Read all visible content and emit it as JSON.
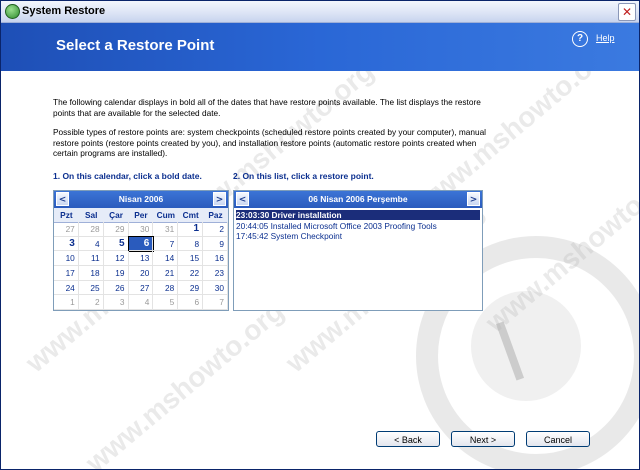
{
  "window": {
    "title": "System Restore",
    "close_symbol": "✕",
    "icon": "system-restore-icon"
  },
  "header": {
    "title": "Select a Restore Point",
    "help_label": "Help",
    "help_symbol": "?"
  },
  "intro": {
    "paragraph1": "The following calendar displays in bold all of the dates that have restore points available. The list displays the restore points that are available for the selected date.",
    "paragraph2": "Possible types of restore points are: system checkpoints (scheduled restore points created by your computer), manual restore points (restore points created by you), and installation restore points (automatic restore points created when certain programs are installed)."
  },
  "steps": {
    "step1": "1. On this calendar, click a bold date.",
    "step2": "2. On this list, click a restore point."
  },
  "calendar": {
    "title": "Nisan 2006",
    "prev_symbol": "<",
    "next_symbol": ">",
    "days_of_week": [
      "Pzt",
      "Sal",
      "Çar",
      "Per",
      "Cum",
      "Cmt",
      "Paz"
    ],
    "weeks": [
      [
        {
          "d": "27",
          "t": "other"
        },
        {
          "d": "28",
          "t": "other"
        },
        {
          "d": "29",
          "t": "other"
        },
        {
          "d": "30",
          "t": "other"
        },
        {
          "d": "31",
          "t": "other"
        },
        {
          "d": "1",
          "t": "bold"
        },
        {
          "d": "2",
          "t": "normal"
        }
      ],
      [
        {
          "d": "3",
          "t": "bold"
        },
        {
          "d": "4",
          "t": "normal"
        },
        {
          "d": "5",
          "t": "bold"
        },
        {
          "d": "6",
          "t": "sel"
        },
        {
          "d": "7",
          "t": "normal"
        },
        {
          "d": "8",
          "t": "normal"
        },
        {
          "d": "9",
          "t": "normal"
        }
      ],
      [
        {
          "d": "10",
          "t": "normal"
        },
        {
          "d": "11",
          "t": "normal"
        },
        {
          "d": "12",
          "t": "normal"
        },
        {
          "d": "13",
          "t": "normal"
        },
        {
          "d": "14",
          "t": "normal"
        },
        {
          "d": "15",
          "t": "normal"
        },
        {
          "d": "16",
          "t": "normal"
        }
      ],
      [
        {
          "d": "17",
          "t": "normal"
        },
        {
          "d": "18",
          "t": "normal"
        },
        {
          "d": "19",
          "t": "normal"
        },
        {
          "d": "20",
          "t": "normal"
        },
        {
          "d": "21",
          "t": "normal"
        },
        {
          "d": "22",
          "t": "normal"
        },
        {
          "d": "23",
          "t": "normal"
        }
      ],
      [
        {
          "d": "24",
          "t": "normal"
        },
        {
          "d": "25",
          "t": "normal"
        },
        {
          "d": "26",
          "t": "normal"
        },
        {
          "d": "27",
          "t": "normal"
        },
        {
          "d": "28",
          "t": "normal"
        },
        {
          "d": "29",
          "t": "normal"
        },
        {
          "d": "30",
          "t": "normal"
        }
      ],
      [
        {
          "d": "1",
          "t": "other"
        },
        {
          "d": "2",
          "t": "other"
        },
        {
          "d": "3",
          "t": "other"
        },
        {
          "d": "4",
          "t": "other"
        },
        {
          "d": "5",
          "t": "other"
        },
        {
          "d": "6",
          "t": "other"
        },
        {
          "d": "7",
          "t": "other"
        }
      ]
    ]
  },
  "restore_list": {
    "title": "06 Nisan 2006 Perşembe",
    "prev_symbol": "<",
    "next_symbol": ">",
    "items": [
      {
        "text": "23:03:30  Driver installation",
        "selected": true
      },
      {
        "text": "20:44:05  Installed Microsoft Office 2003 Proofing Tools",
        "selected": false
      },
      {
        "text": "17:45:42  System Checkpoint",
        "selected": false
      }
    ]
  },
  "buttons": {
    "back": "< Back",
    "next": "Next >",
    "cancel": "Cancel"
  },
  "watermark": "www.mshowto.org",
  "colors": {
    "header_blue": "#2a67d6",
    "link_blue": "#0b2f8f",
    "selection": "#1b2d7a"
  }
}
